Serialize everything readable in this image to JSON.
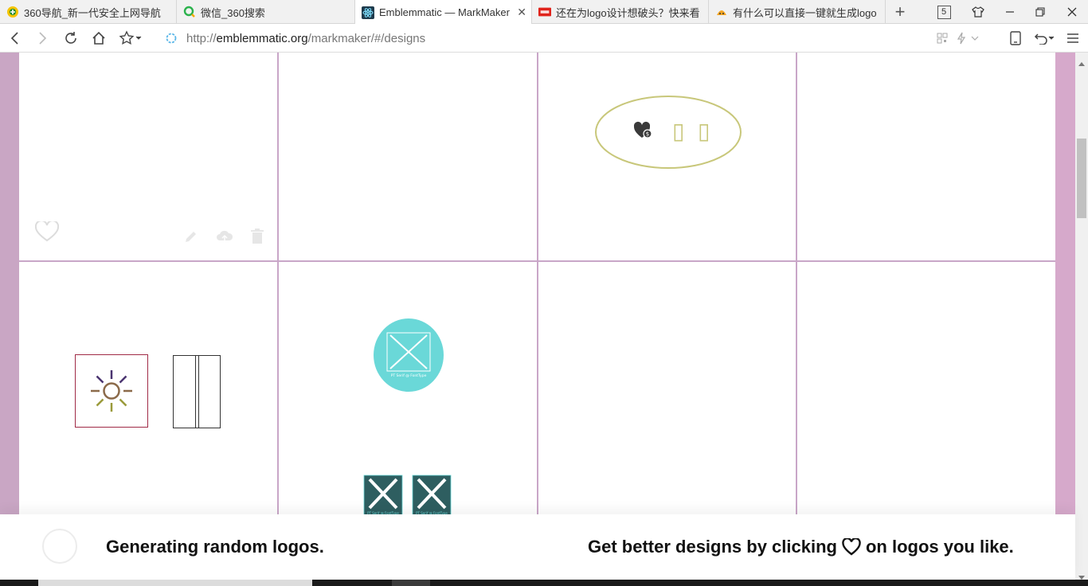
{
  "browser": {
    "tabs": [
      {
        "title": "360导航_新一代安全上网导航",
        "favicon": "360-nav-icon",
        "active": false
      },
      {
        "title": "微信_360搜索",
        "favicon": "360-search-icon",
        "active": false
      },
      {
        "title": "Emblemmatic — MarkMaker",
        "favicon": "react-atom-icon",
        "active": true
      },
      {
        "title": "还在为logo设计想破头？快来看",
        "favicon": "news-badge-icon",
        "active": false
      },
      {
        "title": "有什么可以直接一键就生成logo",
        "favicon": "wukong-icon",
        "active": false
      }
    ],
    "tab_count": "5",
    "tab_close_glyph": "✕",
    "new_tab_glyph": "+",
    "url_scheme": "http://",
    "url_host": "emblemmatic.org",
    "url_path": "/markmaker/#/designs"
  },
  "designs": {
    "cell_actions": [
      "heart-icon",
      "pencil-icon",
      "cloud-upload-icon",
      "trash-icon"
    ],
    "colors": {
      "grid_line": "#c9a6c8",
      "page_bg": "#d6a9cb",
      "olive": "#c8c77a",
      "maroon": "#a02a46",
      "teal": "#6ad8d8",
      "dark_teal": "#2e5e60"
    },
    "tiles": [
      {
        "name": "tile-1",
        "content": "empty with action icons"
      },
      {
        "name": "tile-2",
        "content": "empty"
      },
      {
        "name": "tile-3",
        "content": "olive ellipse with heart-badge-icon and two placeholder glyphs"
      },
      {
        "name": "tile-4",
        "content": "empty"
      },
      {
        "name": "tile-5",
        "content": "sun-icon in maroon square, outlined rectangle"
      },
      {
        "name": "tile-6",
        "content": "teal circle with missing-image-icon, two dark teal missing-image-icons"
      },
      {
        "name": "tile-7",
        "content": "empty"
      },
      {
        "name": "tile-8",
        "content": "empty"
      }
    ],
    "placeholder_glyphs": [
      "▯",
      "▯"
    ],
    "font_missing_text": "PT Serif @ FontType"
  },
  "notice": {
    "left": "Generating random logos.",
    "right_before": "Get better designs by clicking",
    "right_after": "on logos you like."
  }
}
